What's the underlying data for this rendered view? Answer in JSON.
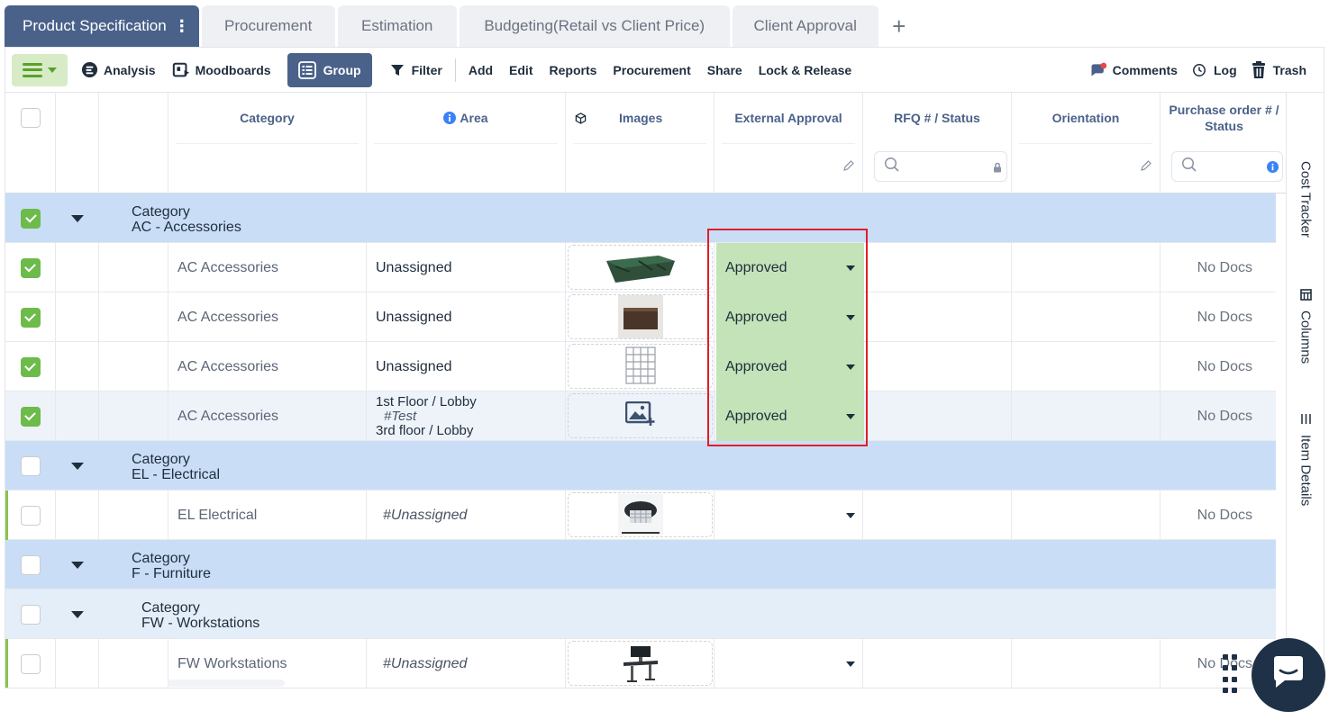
{
  "tabs": [
    {
      "label": "Product Specification",
      "active": true
    },
    {
      "label": "Procurement"
    },
    {
      "label": "Estimation"
    },
    {
      "label": "Budgeting(Retail vs Client Price)"
    },
    {
      "label": "Client Approval"
    }
  ],
  "tabs_more": "⋮",
  "tabs_add": "+",
  "toolbar": {
    "analysis": "Analysis",
    "moodboards": "Moodboards",
    "group": "Group",
    "filter": "Filter",
    "add": "Add",
    "edit": "Edit",
    "reports": "Reports",
    "procurement": "Procurement",
    "share": "Share",
    "lock_release": "Lock & Release",
    "comments": "Comments",
    "log": "Log",
    "trash": "Trash"
  },
  "columns": {
    "category": "Category",
    "area": "Area",
    "images": "Images",
    "external_approval": "External Approval",
    "rfq": "RFQ # / Status",
    "orientation": "Orientation",
    "purchase_order": "Purchase order # / Status"
  },
  "groups": {
    "label": "Category",
    "accessories": "AC - Accessories",
    "electrical": "EL - Electrical",
    "furniture": "F - Furniture",
    "workstations": "FW - Workstations"
  },
  "rows": [
    {
      "category": "AC Accessories",
      "area": "Unassigned",
      "approval": "Approved",
      "po": "No Docs",
      "image": "green-marble-block"
    },
    {
      "category": "AC Accessories",
      "area": "Unassigned",
      "approval": "Approved",
      "po": "No Docs",
      "image": "wood-cabinet"
    },
    {
      "category": "AC Accessories",
      "area": "Unassigned",
      "approval": "Approved",
      "po": "No Docs",
      "image": "wire-rack"
    },
    {
      "category": "AC Accessories",
      "area_line1": "1st Floor / Lobby",
      "area_line2": "#Test",
      "area_line3": "3rd floor / Lobby",
      "approval": "Approved",
      "po": "No Docs",
      "image": "add-image-icon"
    },
    {
      "category": "EL Electrical",
      "area": "#Unassigned",
      "approval": "",
      "po": "No Docs",
      "image": "pendant-lamp"
    },
    {
      "category": "FW Workstations",
      "area": "#Unassigned",
      "approval": "",
      "po": "No Docs",
      "image": "standing-desk"
    }
  ],
  "side_panel": {
    "cost_tracker": "Cost Tracker",
    "columns": "Columns",
    "item_details": "Item Details"
  },
  "colors": {
    "primary": "#4a628a",
    "approved_bg": "#c4e3b8",
    "group_row": "#c9def6",
    "highlight_border": "#e11d2a",
    "check_green": "#6dbb4a"
  }
}
